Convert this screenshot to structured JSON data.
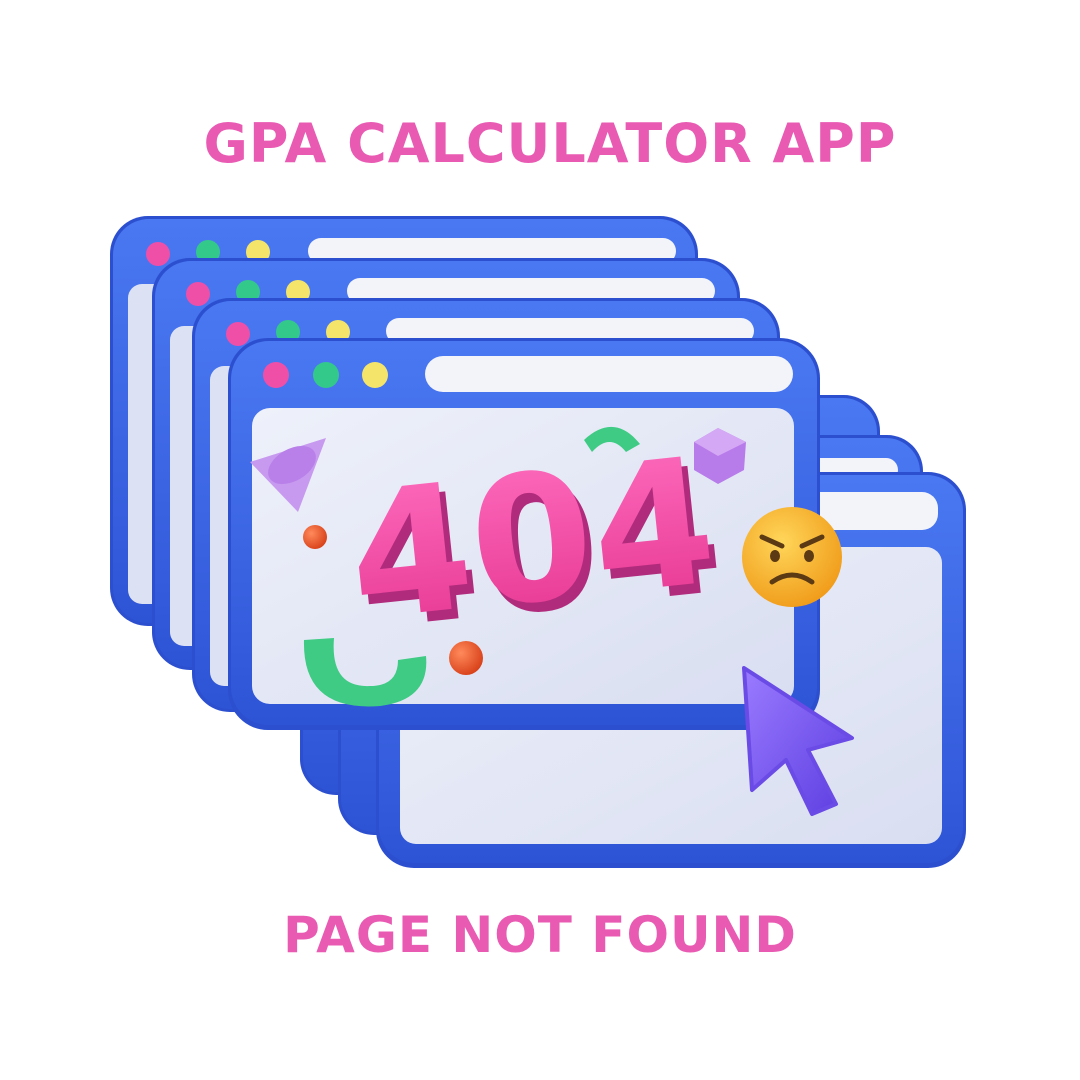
{
  "header": {
    "app_title": "GPA CALCULATOR APP"
  },
  "illustration": {
    "error_code": "404",
    "emoji": "angry-face",
    "icon": "mouse-cursor-icon"
  },
  "footer": {
    "message": "PAGE NOT FOUND"
  },
  "colors": {
    "accent_pink": "#E95AB3",
    "window_blue": "#3E6BEA",
    "window_blue_dark": "#2B4FCF",
    "panel": "#E3E7F6",
    "dot_pink": "#F04FA8",
    "dot_green": "#33C98A",
    "dot_yellow": "#F4E56A",
    "number_pink": "#F0439F",
    "number_shadow": "#B12B7C",
    "cursor_purple": "#7A5CF0",
    "green_shape": "#3FCB84",
    "orange_ball": "#EF5A2A",
    "emoji_yellow": "#F7B928"
  }
}
